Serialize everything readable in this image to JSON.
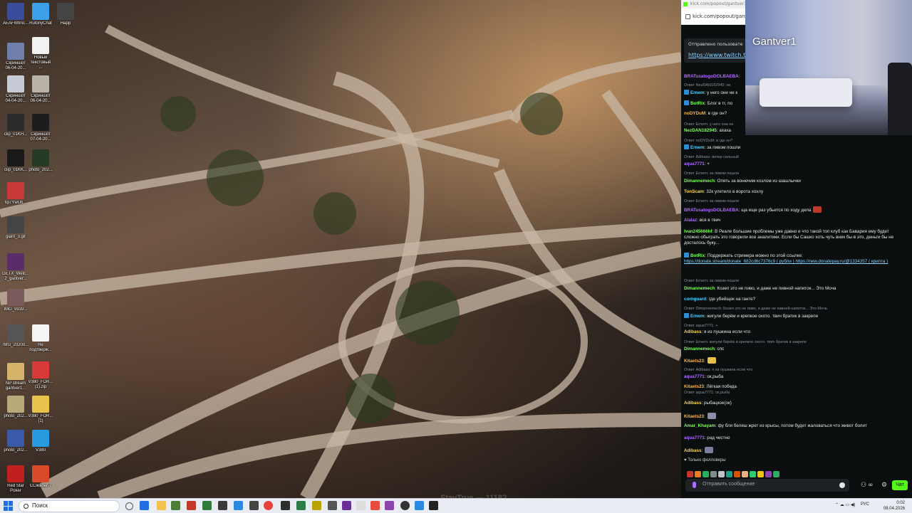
{
  "desktop_icons": [
    {
      "label": "AEAFWtmc...",
      "color": "#3b4d9a"
    },
    {
      "label": "RutonyChat",
      "color": "#3aa0e8"
    },
    {
      "label": "Happ",
      "color": "#444444"
    },
    {
      "label": "Скриншот\n06-04-20...",
      "color": "#6d7faa"
    },
    {
      "label": "Новый\nтекстовый\n...",
      "color": "#f2f2f2"
    },
    {
      "label": "Скриншот\n04-04-20...",
      "color": "#c7cbd6"
    },
    {
      "label": "Скриншот\n06-04-20...",
      "color": "#b9b2a8"
    },
    {
      "label": "clip_01KH...",
      "color": "#2b2b2b"
    },
    {
      "label": "Скриншот\n07-04-20...",
      "color": "#1d1d1d"
    },
    {
      "label": "clip_01KK...",
      "color": "#1a1a1a"
    },
    {
      "label": "photo_202...",
      "color": "#263a26"
    },
    {
      "label": "fqi7YwUb...",
      "color": "#c83a3a"
    },
    {
      "label": "giant_3.gif",
      "color": "#444444"
    },
    {
      "label": "GETX_Welc...\n2_gantver...",
      "color": "#5a2d6a"
    },
    {
      "label": "IMG_9939...",
      "color": "#7a5a5a"
    },
    {
      "label": "IMG_20200...",
      "color": "#555555"
    },
    {
      "label": "Не\nподтверж...",
      "color": "#f4f4f4"
    },
    {
      "label": "NP stream\ngantver1...",
      "color": "#d4b36a"
    },
    {
      "label": "V380_FOR...\n(1).zip",
      "color": "#d83a3a"
    },
    {
      "label": "photo_202...",
      "color": "#b9a87a"
    },
    {
      "label": "V380_FOR...\n(1)",
      "color": "#e8c24a"
    },
    {
      "label": "photo_202...",
      "color": "#3a5aa8"
    },
    {
      "label": "V380",
      "color": "#2a9ae0"
    },
    {
      "label": "Red Star\nPoker",
      "color": "#c21f1f"
    },
    {
      "label": "CCleaner 7",
      "color": "#d94a2a"
    }
  ],
  "browser": {
    "url_bar_1": "kick.com/popout/gantver1/ch",
    "url_bar_2": "kick.com/popout/gantv",
    "pinned_label": "Отправлено пользовате",
    "pinned_url": "https://www.twitch.tv/ga"
  },
  "webcam": {
    "name": "Gantver1"
  },
  "chat": [
    {
      "type": "msg",
      "user": "BRATusatogoDOLBAEBA",
      "color": "#b06cff",
      "text": ":"
    },
    {
      "type": "reply",
      "text": "Ответ NezDAN182945: не"
    },
    {
      "type": "msg",
      "badge": true,
      "user": "Ernem",
      "color": "#52d1ff",
      "text": ": у него они не к"
    },
    {
      "type": "msg",
      "badge": true,
      "user": "BotRix",
      "color": "#7dff5a",
      "text": ": Блог в тг, по"
    },
    {
      "type": "msg",
      "user": "noDYDuM",
      "color": "#ffb347",
      "text": ": в где он?"
    },
    {
      "type": "reply",
      "text": "Ответ Ernem: у него они не"
    },
    {
      "type": "msg",
      "user": "NezDAN182945",
      "color": "#7dff5a",
      "text": ": ахаха"
    },
    {
      "type": "reply",
      "text": "Ответ noDYDuM: в где он?"
    },
    {
      "type": "msg",
      "badge": true,
      "user": "Ernem",
      "color": "#52d1ff",
      "text": ": за пивом пошли"
    },
    {
      "type": "reply",
      "text": "Ответ Adibass: ветер сильный"
    },
    {
      "type": "msg",
      "user": "aqua7771",
      "color": "#b06cff",
      "text": ": +"
    },
    {
      "type": "reply",
      "text": "Ответ Ernem: за пивом пошли"
    },
    {
      "type": "msg",
      "user": "Dimannemech",
      "color": "#7dff5a",
      "text": ": Опять за вонючим козлом из шашлычки"
    },
    {
      "type": "msg",
      "user": "TonScam",
      "color": "#ffd84a",
      "text": ": 32к улетело в ворота хохлу"
    },
    {
      "type": "reply",
      "text": "Ответ Ernem: за пивом пошли"
    },
    {
      "type": "msg",
      "user": "BRATusatogoDOLBAEBA",
      "color": "#b06cff",
      "text": ": ща еще раз убьется по ходу дела",
      "emoji": "#c0392b"
    },
    {
      "type": "msg",
      "user": "Alalaz",
      "color": "#b06cff",
      "text": ": вся в твич"
    },
    {
      "type": "msg",
      "user": "Ivan245666hf",
      "color": "#7dff5a",
      "text": ": В Реале большие проблемы уже давно и что такой топ клуб как Бавария ему будет сложно обыграть это говорили все аналитики. Если бы Сашко хоть чуть вник бы в это, деньги бы не досталось букy...",
      "wrap": true
    },
    {
      "type": "msg",
      "badge": true,
      "user": "BotRix",
      "color": "#7dff5a",
      "text": ": Поддержать стримера можно по этой ссылке:",
      "links": "https://donate.stream/donate_682cd6c7376c9 ( рубли ) https://new.donatepay.ru/@1334357 ( крипта )"
    },
    {
      "type": "reply",
      "text": "Ответ Ernem: за пивом пошли"
    },
    {
      "type": "msg",
      "user": "Dimannemech",
      "color": "#7dff5a",
      "text": ": Козел это не пиво, и даже не пивной напиток... Это Моча"
    },
    {
      "type": "msg",
      "user": "cornguard",
      "color": "#52d1ff",
      "text": ": где убейщек на ганте?"
    },
    {
      "type": "reply",
      "text": "Ответ Dimannemech: Козел это не пиво, и даже не пивной напиток... Это Моча"
    },
    {
      "type": "msg",
      "badge": true,
      "user": "Ernem",
      "color": "#52d1ff",
      "text": ": жигули берём и крепкое охото. твич братик в закрепе"
    },
    {
      "type": "reply",
      "text": "Ответ aqua7771: +"
    },
    {
      "type": "msg",
      "user": "Adibass",
      "color": "#ffd84a",
      "text": ": я из пушкина если что"
    },
    {
      "type": "reply",
      "text": "Ответ Ernem: жигули берём и крепкое охото. твич братик в закрепе"
    },
    {
      "type": "msg",
      "user": "Dimannemech",
      "color": "#7dff5a",
      "text": ": спс"
    },
    {
      "type": "msg",
      "user": "Kitaets23",
      "color": "#ffb347",
      "text": ":",
      "emoji": "#e6c14a"
    },
    {
      "type": "reply",
      "text": "Ответ Adibass: я из пушкина если что"
    },
    {
      "type": "msg",
      "user": "aqua7771",
      "color": "#b06cff",
      "text": ": ок,рыба"
    },
    {
      "type": "msg",
      "user": "Kitaets23",
      "color": "#ffb347",
      "text": ": Лёгкая победа"
    },
    {
      "type": "reply",
      "text": "Ответ aqua7771: ок,рыба"
    },
    {
      "type": "msg",
      "user": "Adibass",
      "color": "#ffd84a",
      "text": ": рыбацкое(ок)"
    },
    {
      "type": "msg",
      "user": "Kitaets23",
      "color": "#ffb347",
      "text": ":",
      "emoji": "#8a8fa8"
    },
    {
      "type": "msg",
      "user": "Amar_Khayam",
      "color": "#7dff5a",
      "text": ": фу бля беляш жрет из крысы, потом будет жаловаться что живот болит"
    },
    {
      "type": "msg",
      "user": "aqua7771",
      "color": "#b06cff",
      "text": ": рад честно"
    },
    {
      "type": "msg",
      "user": "Adibass",
      "color": "#ffd84a",
      "text": ":",
      "emoji": "#7a7fa0"
    }
  ],
  "chat_footer": {
    "followers_only": "Только фолловеры",
    "input_placeholder": "Отправить сообщение",
    "send_label": "Чат"
  },
  "taskbar": {
    "search_label": "Поиск",
    "watermark": "StayTrue — 1118?",
    "language": "РУС",
    "time": "0:02",
    "date": "08.04.2026"
  }
}
